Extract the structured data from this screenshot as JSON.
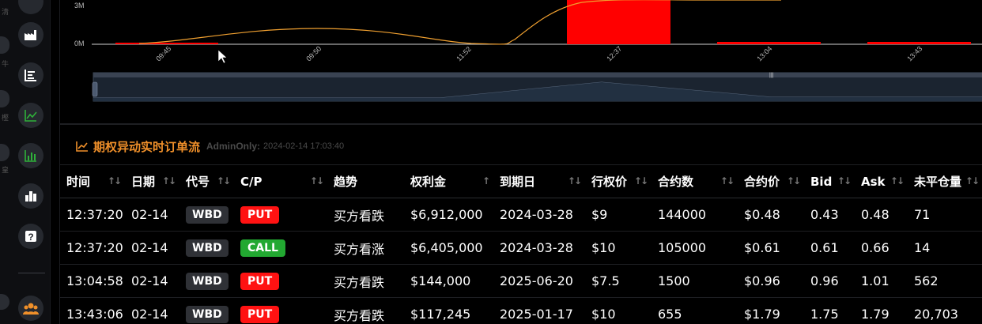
{
  "chart": {
    "y_axis_labels": [
      "3M",
      "0M"
    ],
    "x_axis_labels": [
      "09:45",
      "09:50",
      "11:52",
      "12:37",
      "13:04",
      "13:43"
    ],
    "bar_color": "#ff0000",
    "line_color": "#f0a030"
  },
  "section": {
    "title": "期权异动实时订单流",
    "admin_label": "AdminOnly:",
    "timestamp": "2024-02-14 17:03:40",
    "icon": "trend-chart-icon"
  },
  "table": {
    "headers": [
      "时间",
      "日期",
      "代号",
      "C/P",
      "趋势",
      "权利金",
      "到期日",
      "行权价",
      "合约数",
      "合约价",
      "Bid",
      "Ask",
      "未平仓量"
    ],
    "rows": [
      {
        "time": "12:37:20",
        "date": "02-14",
        "ticker": "WBD",
        "cp": "PUT",
        "trend": "买方看跌",
        "premium": "$6,912,000",
        "expiry": "2024-03-28",
        "strike": "$9",
        "contracts": "144000",
        "price": "$0.48",
        "bid": "0.43",
        "ask": "0.48",
        "oi": "71"
      },
      {
        "time": "12:37:20",
        "date": "02-14",
        "ticker": "WBD",
        "cp": "CALL",
        "trend": "买方看涨",
        "premium": "$6,405,000",
        "expiry": "2024-03-28",
        "strike": "$10",
        "contracts": "105000",
        "price": "$0.61",
        "bid": "0.61",
        "ask": "0.66",
        "oi": "14"
      },
      {
        "time": "13:04:58",
        "date": "02-14",
        "ticker": "WBD",
        "cp": "PUT",
        "trend": "买方看跌",
        "premium": "$144,000",
        "expiry": "2025-06-20",
        "strike": "$7.5",
        "contracts": "1500",
        "price": "$0.96",
        "bid": "0.96",
        "ask": "1.01",
        "oi": "562"
      },
      {
        "time": "13:43:06",
        "date": "02-14",
        "ticker": "WBD",
        "cp": "PUT",
        "trend": "买方看跌",
        "premium": "$117,245",
        "expiry": "2025-01-17",
        "strike": "$10",
        "contracts": "655",
        "price": "$1.79",
        "bid": "1.75",
        "ask": "1.79",
        "oi": "20,703"
      }
    ]
  },
  "sidebar": {
    "icons": [
      "factory-icon",
      "list-chart-icon",
      "trend-up-icon",
      "bar-chart-icon",
      "column-chart-icon",
      "help-icon",
      "users-icon"
    ]
  }
}
